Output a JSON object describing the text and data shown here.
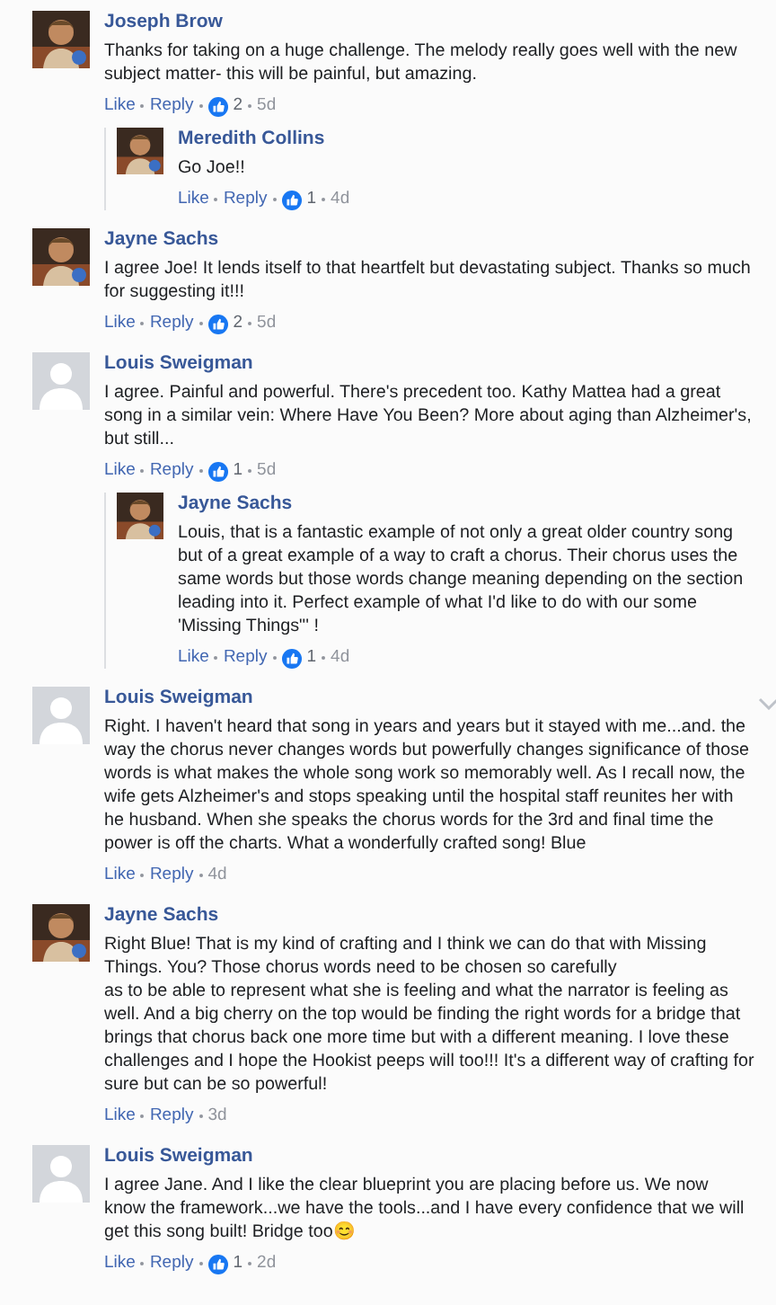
{
  "comments": [
    {
      "author": "Joseph Brow",
      "text": "Thanks for taking on a huge challenge. The melody really goes well with the new subject matter- this will be painful, but amazing.",
      "like": "Like",
      "reply": "Reply",
      "likes": "2",
      "time": "5d",
      "replies": [
        {
          "author": "Meredith Collins",
          "text": "Go Joe!!",
          "like": "Like",
          "reply": "Reply",
          "likes": "1",
          "time": "4d"
        }
      ]
    },
    {
      "author": "Jayne Sachs",
      "text": "I agree Joe! It lends itself to that heartfelt but devastating subject. Thanks so much for suggesting it!!!",
      "like": "Like",
      "reply": "Reply",
      "likes": "2",
      "time": "5d"
    },
    {
      "author": "Louis Sweigman",
      "kind": "default",
      "text": "I agree. Painful and powerful. There's precedent too. Kathy Mattea had a great song in a similar vein: Where Have You Been? More about aging than Alzheimer's, but still...",
      "like": "Like",
      "reply": "Reply",
      "likes": "1",
      "time": "5d",
      "replies": [
        {
          "author": "Jayne Sachs",
          "text": "Louis, that is a fantastic example of not only a great older country song but of a great example of a way to craft a chorus. Their chorus uses the same words but those words change meaning depending on the section leading into it. Perfect example of what I'd like to do with our some 'Missing Things\"' !",
          "like": "Like",
          "reply": "Reply",
          "likes": "1",
          "time": "4d"
        }
      ]
    },
    {
      "author": "Louis Sweigman",
      "kind": "default",
      "text": "Right. I haven't heard that song in years and years but it stayed with me...and. the way the chorus never changes words but powerfully changes significance of those words is what makes the whole song work so memorably well. As I recall now, the wife gets Alzheimer's and stops speaking until the hospital staff reunites her with he husband. When she speaks the chorus words for the 3rd and final time the power is off the charts. What a wonderfully crafted song! Blue",
      "like": "Like",
      "reply": "Reply",
      "time": "4d",
      "menu": true
    },
    {
      "author": "Jayne Sachs",
      "text": "Right Blue! That is my kind of crafting and I think we can do that with Missing Things. You? Those chorus words need to be chosen so carefully\nas to be able to represent what she is feeling and what the narrator is feeling as well. And a big cherry on the top would be finding the right words for a bridge that brings that chorus back one more time but with a different meaning. I love these challenges and I hope the Hookist peeps will too!!! It's a different way of crafting for sure but can be so powerful!",
      "like": "Like",
      "reply": "Reply",
      "time": "3d"
    },
    {
      "author": "Louis Sweigman",
      "kind": "default",
      "text": "I agree Jane. And I like the clear blueprint you are placing before us. We now know the framework...we have the tools...and I have every confidence that we will get this song built! Bridge too😊",
      "like": "Like",
      "reply": "Reply",
      "likes": "1",
      "time": "2d"
    }
  ]
}
